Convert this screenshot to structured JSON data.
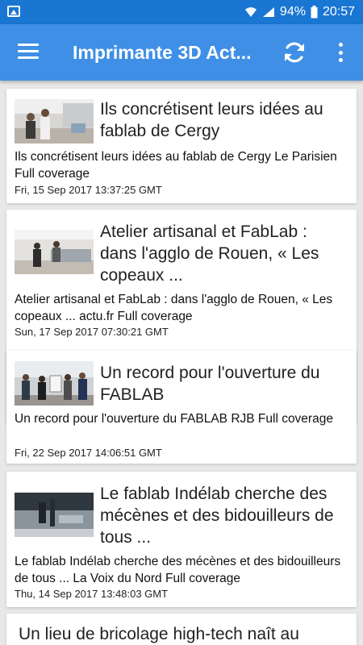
{
  "status_bar": {
    "battery": "94%",
    "time": "20:57"
  },
  "app_bar": {
    "title": "Imprimante 3D Act..."
  },
  "articles": [
    {
      "title": "Ils concrétisent leurs idées au fablab de Cergy",
      "description": "Ils concrétisent leurs idées au fablab de Cergy  Le Parisien  Full coverage",
      "date": "Fri, 15 Sep 2017 13:37:25 GMT"
    },
    {
      "title": "Atelier artisanal et FabLab : dans l'agglo de Rouen, « Les copeaux ...",
      "description": "Atelier artisanal et FabLab : dans l'agglo de Rouen, « Les copeaux ...  actu.fr  Full coverage",
      "date": "Sun, 17 Sep 2017 07:30:21 GMT"
    },
    {
      "title": "Un record pour l'ouverture du FABLAB",
      "description": "Un record pour l'ouverture du FABLAB  RJB  Full coverage",
      "date": "Fri, 22 Sep 2017 14:06:51 GMT"
    },
    {
      "title": "Le fablab Indélab cherche des mécènes et des bidouilleurs de tous ...",
      "description": "Le fablab Indélab cherche des mécènes et des bidouilleurs de tous ...  La Voix du Nord  Full coverage",
      "date": "Thu, 14 Sep 2017 13:48:03 GMT"
    },
    {
      "title": "Un lieu de bricolage high-tech naît au"
    }
  ]
}
